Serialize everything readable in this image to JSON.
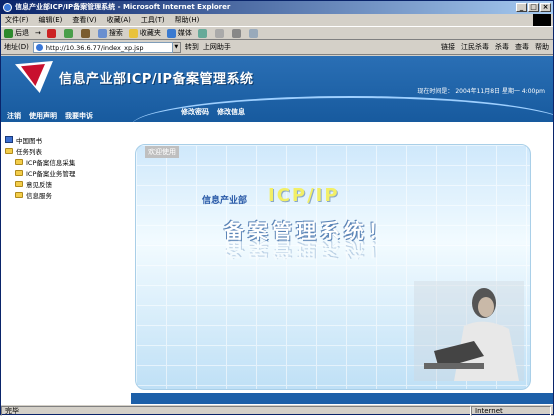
{
  "window": {
    "title": "信息产业部ICP/IP备案管理系统 - Microsoft Internet Explorer"
  },
  "menu": [
    "文件(F)",
    "编辑(E)",
    "查看(V)",
    "收藏(A)",
    "工具(T)",
    "帮助(H)"
  ],
  "toolbar": {
    "back": "后退",
    "search": "搜索",
    "favorites": "收藏夹",
    "media": "媒体"
  },
  "address": {
    "label": "地址(D)",
    "url": "http://10.36.6.77/index_xp.jsp",
    "go": "转到",
    "helper": "上网助手",
    "links": "链接",
    "kill": "江民杀毒",
    "kill2": "杀毒",
    "check": "查毒",
    "help": "帮助"
  },
  "banner": {
    "title": "信息产业部ICP/IP备案管理系统",
    "time": "现在时间是：  2004年11月8日  星期一  4:00pm",
    "nav_left": [
      "注销",
      "使用声明",
      "我要申诉"
    ],
    "nav_right": [
      "修改密码",
      "修改信息"
    ]
  },
  "tree": {
    "root": "中国图书",
    "tasks": "任务列表",
    "items": [
      "ICP备案信息采集",
      "ICP备案业务管理",
      "意见反馈",
      "信息服务"
    ]
  },
  "main": {
    "welcome": "欢迎使用",
    "line1": "信息产业部",
    "line2": "ICP/IP",
    "line3": "备案管理系统！"
  },
  "status": {
    "left": "完毕",
    "zone": "Internet"
  }
}
